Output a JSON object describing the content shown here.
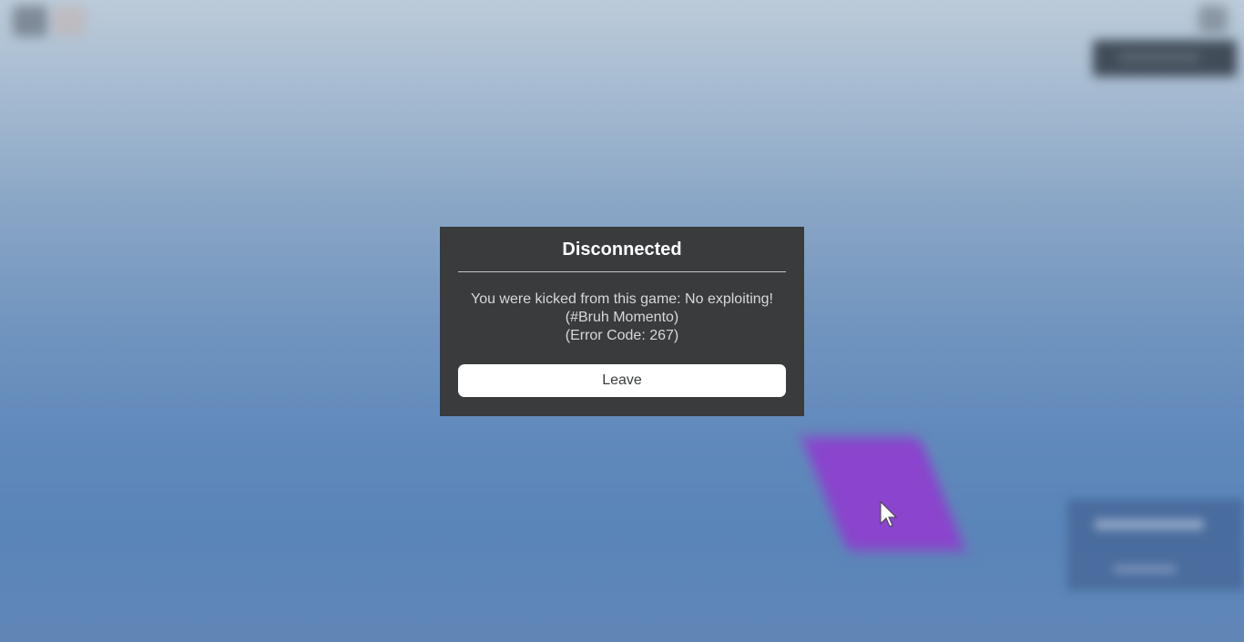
{
  "dialog": {
    "title": "Disconnected",
    "message_lines": [
      "You were kicked from this game: No exploiting!",
      "(#Bruh Momento)",
      "(Error Code: 267)"
    ],
    "leave_label": "Leave"
  },
  "colors": {
    "dialog_background": "#393b3d",
    "button_background": "#ffffff",
    "accent_purple": "#8a44cd",
    "sky_top": "#bccbd9",
    "sky_bottom": "#5a85b8"
  },
  "icons": {
    "cursor": "mouse-pointer-icon",
    "menu": "roblox-menu-icon",
    "chat": "chat-icon"
  }
}
